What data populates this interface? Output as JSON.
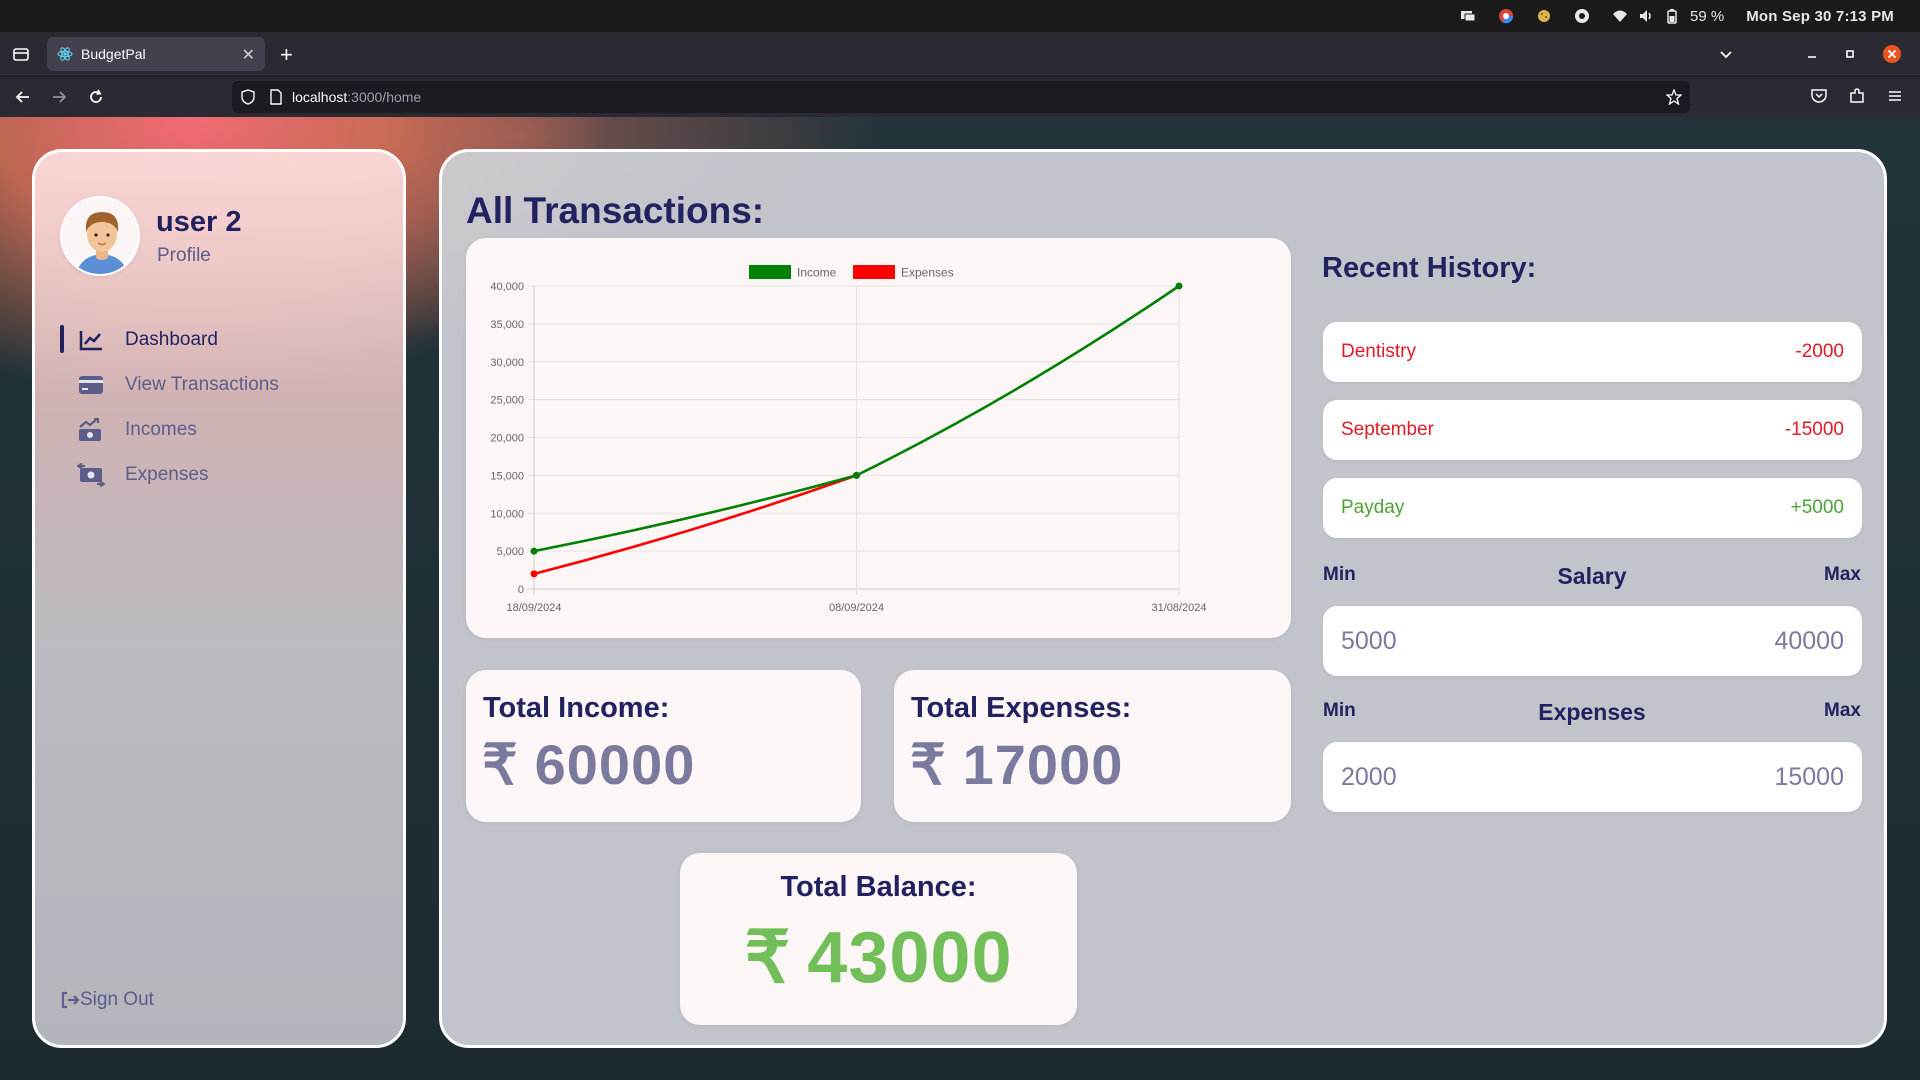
{
  "os": {
    "battery": "59 %",
    "clock": "Mon Sep 30   7:13 PM"
  },
  "browser": {
    "tab_title": "BudgetPal",
    "url_host": "localhost",
    "url_path": ":3000/home"
  },
  "sidebar": {
    "user_name": "user 2",
    "user_sub": "Profile",
    "items": [
      {
        "label": "Dashboard",
        "icon": "chart-line-icon"
      },
      {
        "label": "View Transactions",
        "icon": "credit-card-icon"
      },
      {
        "label": "Incomes",
        "icon": "money-bill-trend-icon"
      },
      {
        "label": "Expenses",
        "icon": "money-bill-transfer-icon"
      }
    ],
    "sign_out": "Sign Out"
  },
  "main": {
    "title": "All Transactions:",
    "total_income": {
      "label": "Total Income:",
      "currency": "₹",
      "value": "60000"
    },
    "total_expenses": {
      "label": "Total Expenses:",
      "currency": "₹",
      "value": "17000"
    },
    "total_balance": {
      "label": "Total Balance:",
      "currency": "₹",
      "value": "43000"
    }
  },
  "history": {
    "title": "Recent History:",
    "items": [
      {
        "name": "Dentistry",
        "amount": "-2000",
        "type": "expense"
      },
      {
        "name": "September",
        "amount": "-15000",
        "type": "expense"
      },
      {
        "name": "Payday",
        "amount": "+5000",
        "type": "income"
      }
    ],
    "salary": {
      "title": "Salary",
      "min_label": "Min",
      "max_label": "Max",
      "min": "5000",
      "max": "40000"
    },
    "expenses": {
      "title": "Expenses",
      "min_label": "Min",
      "max_label": "Max",
      "min": "2000",
      "max": "15000"
    }
  },
  "colors": {
    "navy": "#222260",
    "income_line": "#008000",
    "expense_line": "#ff0000",
    "balance_green": "#72bf5a",
    "negative": "#e01b24",
    "positive": "#4aa336"
  },
  "chart_data": {
    "type": "line",
    "categories": [
      "18/09/2024",
      "08/09/2024",
      "31/08/2024"
    ],
    "series": [
      {
        "name": "Income",
        "values": [
          5000,
          15000,
          40000
        ],
        "color": "#008000"
      },
      {
        "name": "Expenses",
        "values": [
          2000,
          15000,
          null
        ],
        "color": "#ff0000"
      }
    ],
    "ylim": [
      0,
      40000
    ],
    "yticks": [
      0,
      5000,
      10000,
      15000,
      20000,
      25000,
      30000,
      35000,
      40000
    ],
    "ytick_labels": [
      "0",
      "5,000",
      "10,000",
      "15,000",
      "20,000",
      "25,000",
      "30,000",
      "35,000",
      "40,000"
    ],
    "grid": true,
    "legend": "top-center",
    "title": "",
    "xlabel": "",
    "ylabel": ""
  }
}
